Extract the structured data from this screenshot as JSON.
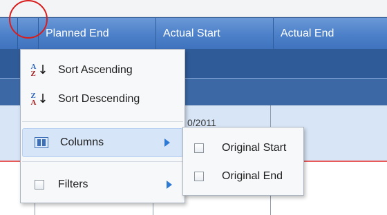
{
  "header": {
    "columns": [
      {
        "label": "Planned End"
      },
      {
        "label": "Actual Start"
      },
      {
        "label": "Actual End"
      }
    ]
  },
  "grid": {
    "partial_date": "0/2011"
  },
  "menu": {
    "items": [
      {
        "label": "Sort Ascending",
        "icon": "sort-ascending-icon"
      },
      {
        "label": "Sort Descending",
        "icon": "sort-descending-icon"
      },
      {
        "label": "Columns",
        "icon": "columns-icon"
      },
      {
        "label": "Filters",
        "icon": "checkbox-icon"
      }
    ]
  },
  "submenu": {
    "items": [
      {
        "label": "Original Start"
      },
      {
        "label": "Original End"
      }
    ]
  },
  "colors": {
    "header_blue": "#4c80c9",
    "dark_row_blue": "#2f5b98",
    "selected_row": "#d7e5f6",
    "menu_highlight": "#d7e5f8",
    "highlight_circle": "#d91d1d",
    "submenu_arrow": "#2e79d4"
  }
}
